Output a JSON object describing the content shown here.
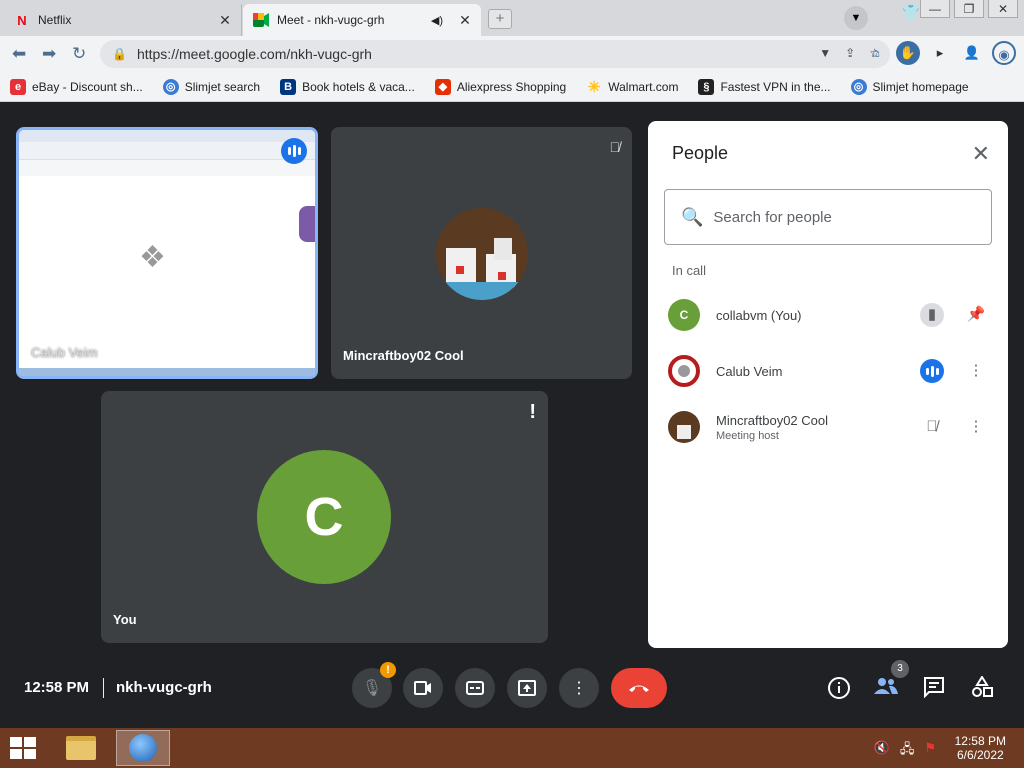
{
  "browser": {
    "tabs": [
      {
        "favicon": "netflix-icon",
        "title": "Netflix"
      },
      {
        "favicon": "meet-icon",
        "title": "Meet - nkh-vugc-grh"
      }
    ],
    "url": "https://meet.google.com/nkh-vugc-grh",
    "bookmarks": [
      {
        "icon": "ebay-icon",
        "label": "eBay - Discount sh..."
      },
      {
        "icon": "globe-icon",
        "label": "Slimjet search"
      },
      {
        "icon": "booking-icon",
        "label": "Book hotels & vaca..."
      },
      {
        "icon": "aliexpress-icon",
        "label": "Aliexpress Shopping"
      },
      {
        "icon": "walmart-icon",
        "label": "Walmart.com"
      },
      {
        "icon": "vpn-icon",
        "label": "Fastest VPN in the..."
      },
      {
        "icon": "globe-icon",
        "label": "Slimjet homepage"
      }
    ]
  },
  "tiles": {
    "share_name": "Calub Veim",
    "mc_name": "Mincraftboy02 Cool",
    "you_name": "You",
    "you_initial": "C"
  },
  "panel": {
    "title": "People",
    "search_placeholder": "Search for people",
    "section": "In call",
    "people": [
      {
        "initial": "C",
        "name": "collabvm (You)",
        "role": "",
        "avatar_color": "#689f38"
      },
      {
        "initial": "",
        "name": "Calub Veim",
        "role": "",
        "avatar_color": "#b71c1c"
      },
      {
        "initial": "",
        "name": "Mincraftboy02 Cool",
        "role": "Meeting host",
        "avatar_color": "#5a3a20"
      }
    ]
  },
  "controls": {
    "time": "12:58 PM",
    "meeting_code": "nkh-vugc-grh",
    "mic_badge": "!",
    "people_count": "3"
  },
  "taskbar": {
    "time": "12:58 PM",
    "date": "6/6/2022"
  },
  "colors": {
    "accent": "#1a73e8",
    "hangup": "#ea4335",
    "self_avatar": "#689f38",
    "badge": "#f29900"
  }
}
